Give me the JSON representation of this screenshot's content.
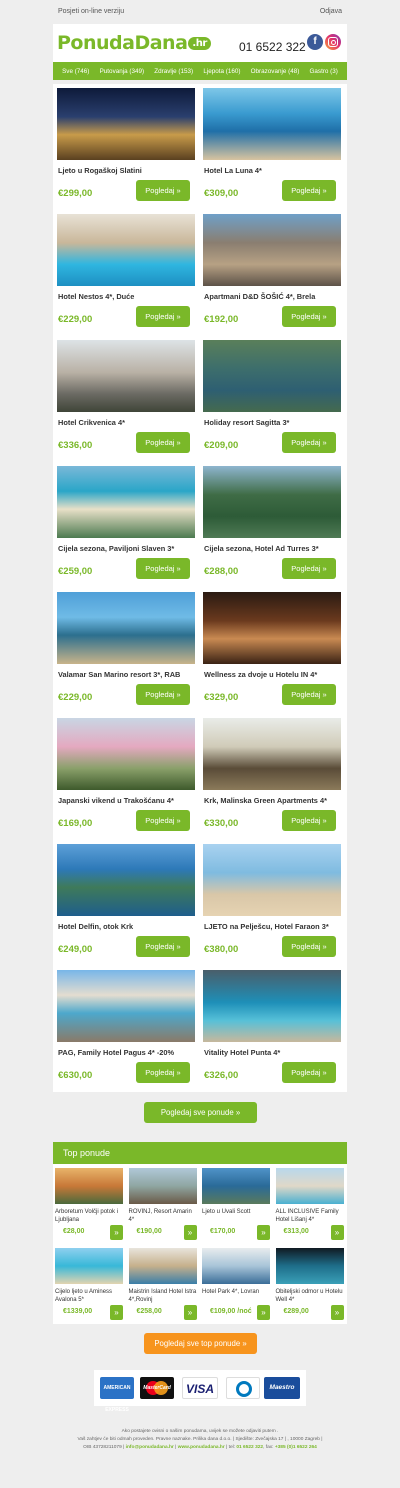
{
  "topbar": {
    "online_link": "Posjeti on-line verziju",
    "unsubscribe_link": "Odjava"
  },
  "header": {
    "logo_text": "PonudaDana",
    "logo_tld": ".hr",
    "phone": "01 6522 322",
    "facebook_icon": "f"
  },
  "categories": [
    "Sve (746)",
    "Putovanja (349)",
    "Zdravlje (153)",
    "Ljepota (160)",
    "Obrazovanje (48)",
    "Gastro (3)"
  ],
  "offer_button_label": "Pogledaj »",
  "offers": [
    {
      "name": "Ljeto u Rogaškoj Slatini",
      "price": "€299,00"
    },
    {
      "name": "Hotel La Luna 4*",
      "price": "€309,00"
    },
    {
      "name": "Hotel Nestos 4*, Duće",
      "price": "€229,00"
    },
    {
      "name": "Apartmani D&D ŠOŠIĆ 4*, Brela",
      "price": "€192,00"
    },
    {
      "name": "Hotel Crikvenica 4*",
      "price": "€336,00"
    },
    {
      "name": "Holiday resort Sagitta 3*",
      "price": "€209,00"
    },
    {
      "name": "Cijela sezona, Paviljoni Slaven 3*",
      "price": "€259,00"
    },
    {
      "name": "Cijela sezona, Hotel Ad Turres 3*",
      "price": "€288,00"
    },
    {
      "name": "Valamar San Marino resort 3*, RAB",
      "price": "€229,00"
    },
    {
      "name": "Wellness za dvoje u Hotelu IN 4*",
      "price": "€329,00"
    },
    {
      "name": "Japanski vikend u Trakošćanu 4*",
      "price": "€169,00"
    },
    {
      "name": "Krk, Malinska Green Apartments 4*",
      "price": "€330,00"
    },
    {
      "name": "Hotel Delfin, otok Krk",
      "price": "€249,00"
    },
    {
      "name": "LJETO na Pelješcu, Hotel Faraon 3*",
      "price": "€380,00"
    },
    {
      "name": "PAG, Family Hotel Pagus 4* -20%",
      "price": "€630,00"
    },
    {
      "name": "Vitality Hotel Punta 4*",
      "price": "€326,00"
    }
  ],
  "all_offers_button": "Pogledaj sve ponude »",
  "top_section": {
    "title": "Top ponude",
    "button_icon": "»",
    "items": [
      {
        "name": "Arboretum Volčji potok i Ljubljana",
        "price": "€28,00"
      },
      {
        "name": "ROVINJ, Resort Amarin 4*",
        "price": "€190,00"
      },
      {
        "name": "Ljeto u Uvali Scott",
        "price": "€170,00"
      },
      {
        "name": "ALL INCLUSIVE Family Hotel Lišanj 4*",
        "price": "€313,00"
      },
      {
        "name": "Cijelo ljeto u Aminess Avalona 5*",
        "price": "€1339,00"
      },
      {
        "name": "Maistrin Island Hotel Istra 4*,Rovinj",
        "price": "€258,00"
      },
      {
        "name": "Hotel Park 4*, Lovran",
        "price": "€109,00 /noć"
      },
      {
        "name": "Obiteljski odmor u Hotelu Well 4*",
        "price": "€289,00"
      }
    ],
    "all_button": "Pogledaj sve top ponude »"
  },
  "payments": {
    "amex": "AMERICAN EXPRESS",
    "mastercard": "MasterCard",
    "visa": "VISA",
    "maestro": "Maestro"
  },
  "footer": {
    "line1": "Ako postajete ovisni o našim ponudama, uvijek se možete odjaviti putem .",
    "line2": "Vaš zahtjev će biti odmah proveden. Pravne naznake. Prilika dana d.o.o. | Sjedište: Zvečajska 17 | , 10000 Zagreb |",
    "line3_prefix": "OIB 43728211079 |",
    "email": "info@ponudadana.hr",
    "website": "www.ponudadana.hr",
    "tel_prefix": "tel:",
    "tel": "01 6522 322",
    "fax_prefix": "fax:",
    "fax": "+385 (0)1 6522 264"
  }
}
